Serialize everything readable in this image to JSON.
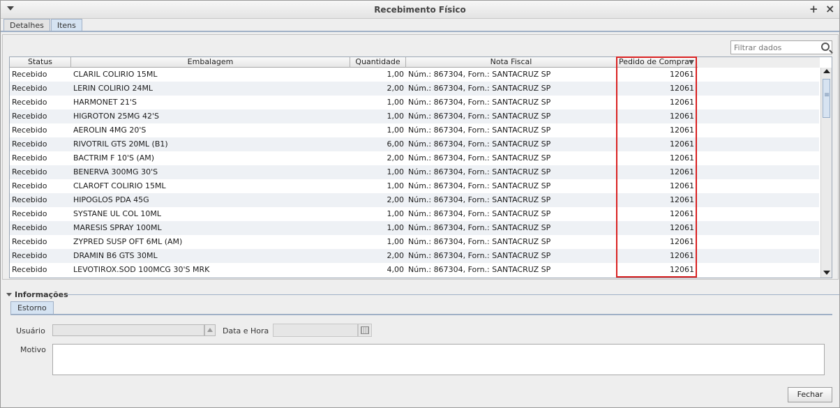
{
  "window": {
    "title": "Recebimento Físico"
  },
  "tabs": [
    {
      "label": "Detalhes",
      "active": false
    },
    {
      "label": "Itens",
      "active": true
    }
  ],
  "filter": {
    "placeholder": "Filtrar dados"
  },
  "table": {
    "columns": [
      "Status",
      "Embalagem",
      "Quantidade",
      "Nota Fiscal",
      "Pedido de Compra"
    ],
    "sorted_column": "Pedido de Compra",
    "rows": [
      [
        "Recebido",
        "CLARIL COLIRIO 15ML",
        "1,00",
        "Núm.: 867304, Forn.: SANTACRUZ SP",
        "12061"
      ],
      [
        "Recebido",
        "LERIN COLIRIO 24ML",
        "2,00",
        "Núm.: 867304, Forn.: SANTACRUZ SP",
        "12061"
      ],
      [
        "Recebido",
        "HARMONET 21'S",
        "1,00",
        "Núm.: 867304, Forn.: SANTACRUZ SP",
        "12061"
      ],
      [
        "Recebido",
        "HIGROTON 25MG 42'S",
        "1,00",
        "Núm.: 867304, Forn.: SANTACRUZ SP",
        "12061"
      ],
      [
        "Recebido",
        "AEROLIN 4MG 20'S",
        "1,00",
        "Núm.: 867304, Forn.: SANTACRUZ SP",
        "12061"
      ],
      [
        "Recebido",
        "RIVOTRIL GTS 20ML (B1)",
        "6,00",
        "Núm.: 867304, Forn.: SANTACRUZ SP",
        "12061"
      ],
      [
        "Recebido",
        "BACTRIM F 10'S (AM)",
        "2,00",
        "Núm.: 867304, Forn.: SANTACRUZ SP",
        "12061"
      ],
      [
        "Recebido",
        "BENERVA 300MG 30'S",
        "1,00",
        "Núm.: 867304, Forn.: SANTACRUZ SP",
        "12061"
      ],
      [
        "Recebido",
        "CLAROFT COLIRIO 15ML",
        "1,00",
        "Núm.: 867304, Forn.: SANTACRUZ SP",
        "12061"
      ],
      [
        "Recebido",
        "HIPOGLOS PDA  45G",
        "2,00",
        "Núm.: 867304, Forn.: SANTACRUZ SP",
        "12061"
      ],
      [
        "Recebido",
        "SYSTANE UL COL 10ML",
        "1,00",
        "Núm.: 867304, Forn.: SANTACRUZ SP",
        "12061"
      ],
      [
        "Recebido",
        "MARESIS SPRAY 100ML",
        "1,00",
        "Núm.: 867304, Forn.: SANTACRUZ SP",
        "12061"
      ],
      [
        "Recebido",
        "ZYPRED SUSP OFT 6ML (AM)",
        "1,00",
        "Núm.: 867304, Forn.: SANTACRUZ SP",
        "12061"
      ],
      [
        "Recebido",
        "DRAMIN B6 GTS 30ML",
        "2,00",
        "Núm.: 867304, Forn.: SANTACRUZ SP",
        "12061"
      ],
      [
        "Recebido",
        "LEVOTIROX.SOD 100MCG 30'S MRK",
        "4,00",
        "Núm.: 867304, Forn.: SANTACRUZ SP",
        "12061"
      ]
    ]
  },
  "info_section": {
    "title": "Informações",
    "tab": "Estorno",
    "usuario_label": "Usuário",
    "usuario_value": "",
    "data_hora_label": "Data e Hora",
    "data_hora_value": "",
    "motivo_label": "Motivo",
    "motivo_value": ""
  },
  "footer": {
    "fechar_label": "Fechar"
  },
  "colors": {
    "highlight": "#d92020",
    "tab_active": "#d5e3f2"
  }
}
